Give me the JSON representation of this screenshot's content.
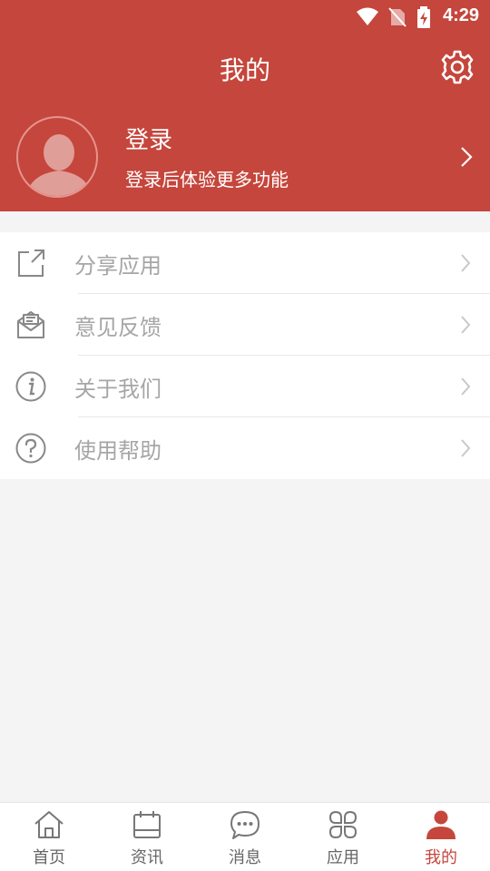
{
  "status_bar": {
    "time": "4:29"
  },
  "header": {
    "title": "我的"
  },
  "profile": {
    "name": "登录",
    "subtitle": "登录后体验更多功能"
  },
  "menu": {
    "items": [
      {
        "label": "分享应用",
        "icon": "share-icon"
      },
      {
        "label": "意见反馈",
        "icon": "feedback-mail-icon"
      },
      {
        "label": "关于我们",
        "icon": "info-icon"
      },
      {
        "label": "使用帮助",
        "icon": "help-icon"
      }
    ]
  },
  "tabbar": {
    "items": [
      {
        "label": "首页",
        "icon": "home-icon"
      },
      {
        "label": "资讯",
        "icon": "news-icon"
      },
      {
        "label": "消息",
        "icon": "message-icon"
      },
      {
        "label": "应用",
        "icon": "apps-icon"
      },
      {
        "label": "我的",
        "icon": "user-icon"
      }
    ],
    "active_index": 4
  },
  "colors": {
    "brand": "#c5463c",
    "inactive_text": "#a6a6a6",
    "background": "#f4f4f4"
  }
}
